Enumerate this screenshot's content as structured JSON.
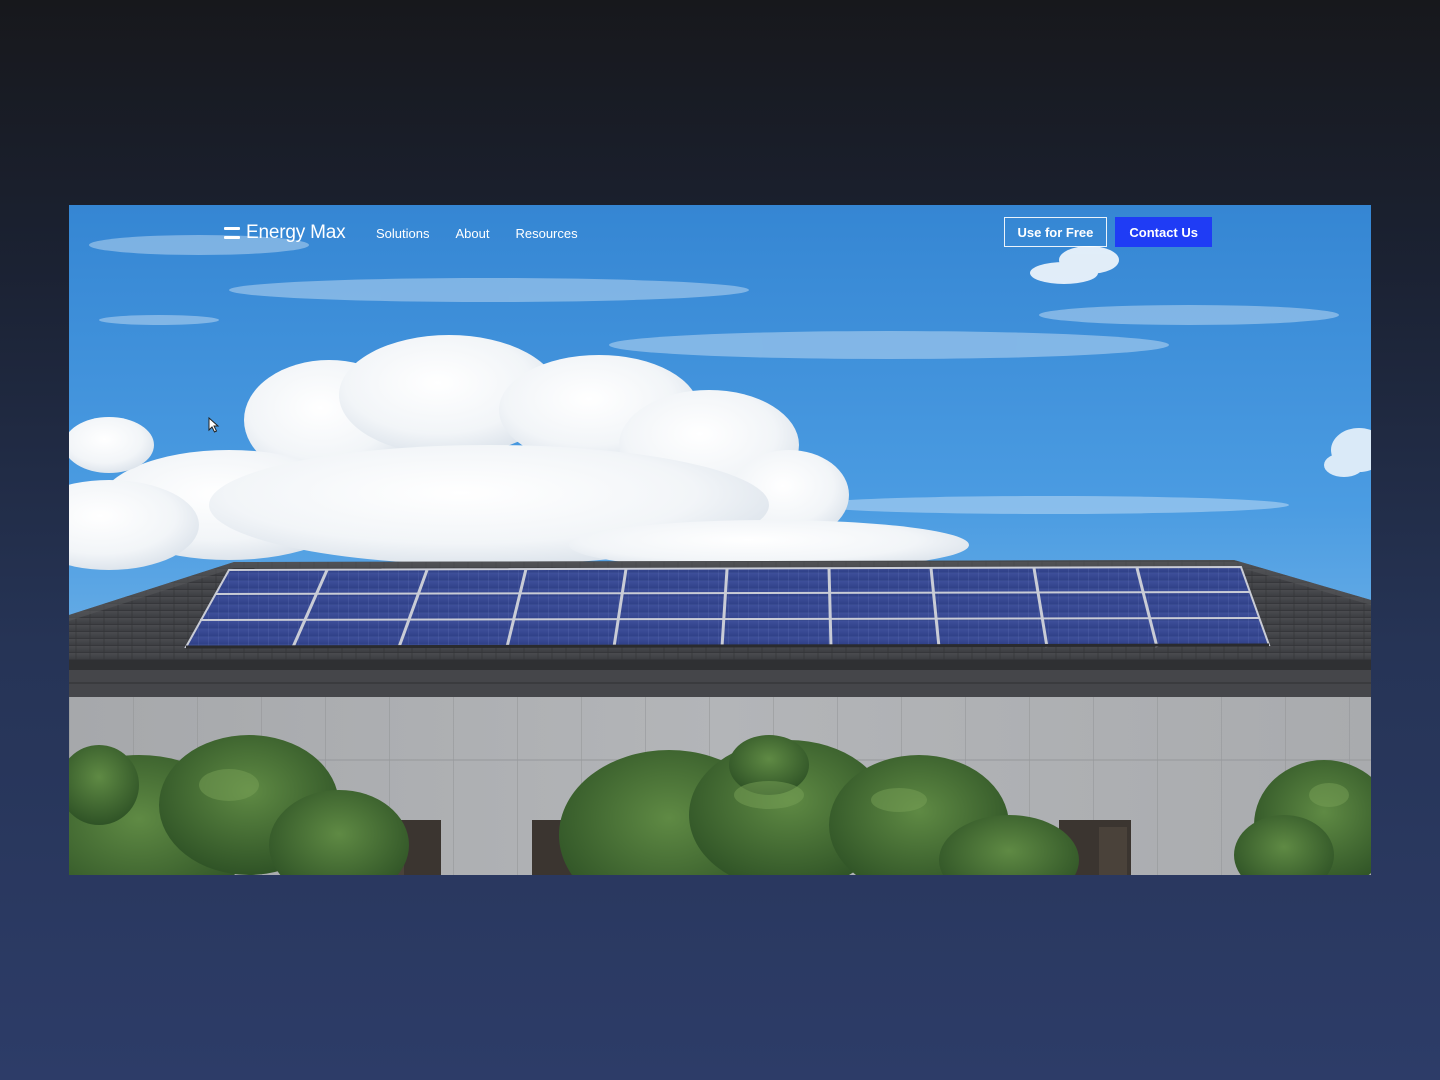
{
  "brand": {
    "name": "Energy Max",
    "icon": "menu-lines-icon"
  },
  "nav": {
    "items": [
      {
        "label": "Solutions"
      },
      {
        "label": "About"
      },
      {
        "label": "Resources"
      }
    ]
  },
  "actions": {
    "secondary_label": "Use for Free",
    "primary_label": "Contact Us"
  },
  "colors": {
    "primary_button": "#1f3cf5",
    "text": "#ffffff"
  },
  "hero": {
    "image": "solar-panel-roof-scene"
  }
}
